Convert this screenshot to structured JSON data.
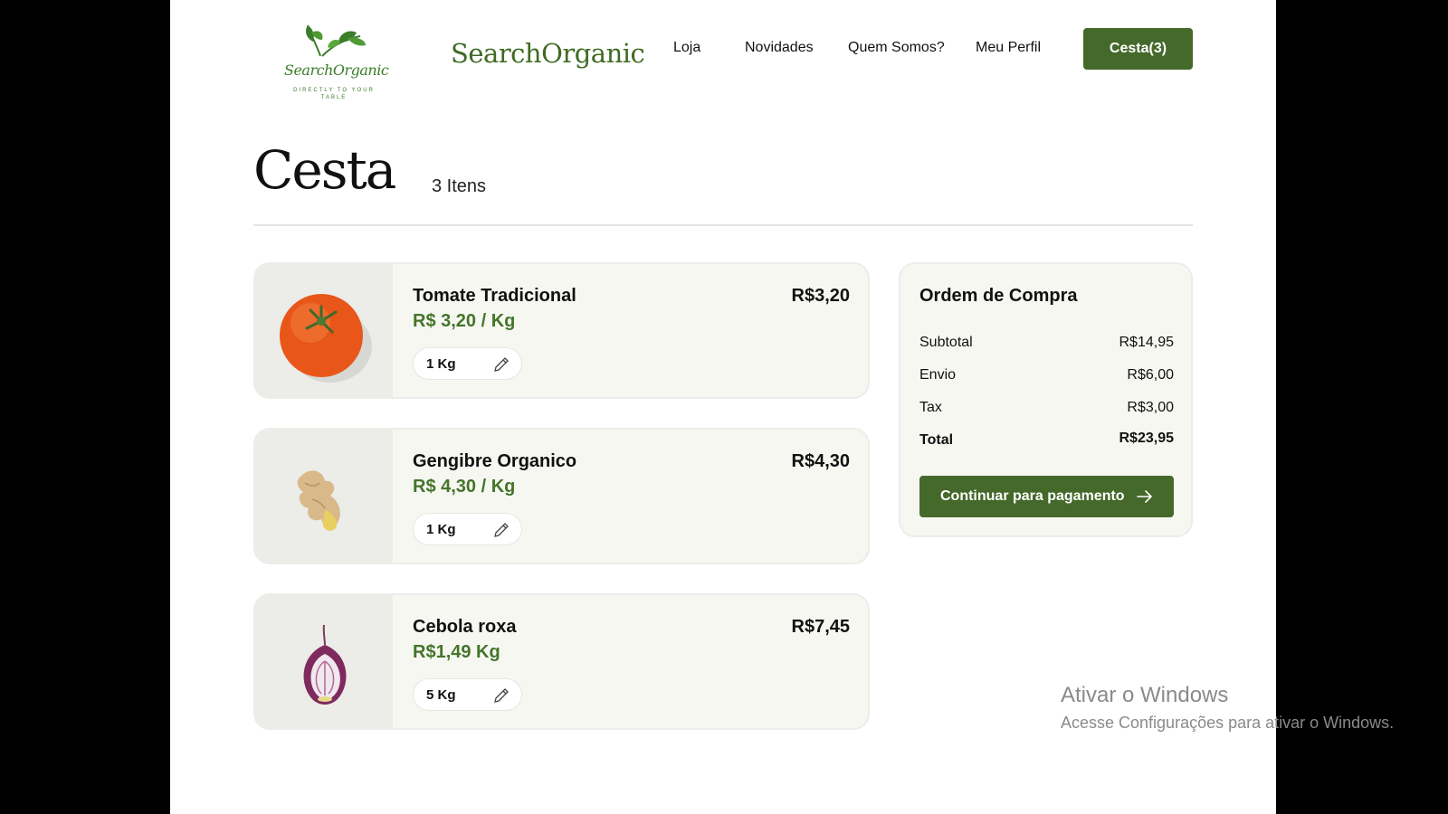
{
  "header": {
    "logo_text": "SearchOrganic",
    "logo_tagline": "DIRECTLY TO YOUR TABLE",
    "brand": "SearchOrganic",
    "nav": [
      "Loja",
      "Novidades",
      "Quem Somos?",
      "Meu Perfil"
    ],
    "cart_button": "Cesta(3)"
  },
  "page": {
    "title": "Cesta",
    "item_count": "3  Itens"
  },
  "items": [
    {
      "name": "Tomate Tradicional",
      "unit_price": "R$ 3,20 / Kg",
      "price": "R$3,20",
      "quantity": "1 Kg",
      "image": "tomato"
    },
    {
      "name": "Gengibre Organico",
      "unit_price": "R$ 4,30 / Kg",
      "price": "R$4,30",
      "quantity": "1 Kg",
      "image": "ginger"
    },
    {
      "name": "Cebola roxa",
      "unit_price": "R$1,49 Kg",
      "price": "R$7,45",
      "quantity": "5 Kg",
      "image": "red-onion"
    }
  ],
  "summary": {
    "title": "Ordem de Compra",
    "rows": [
      {
        "label": "Subtotal",
        "value": "R$14,95"
      },
      {
        "label": "Envio",
        "value": "R$6,00"
      },
      {
        "label": "Tax",
        "value": "R$3,00"
      },
      {
        "label": "Total",
        "value": "R$23,95"
      }
    ],
    "pay_button": "Continuar para pagamento"
  },
  "watermark": {
    "line1": "Ativar o Windows",
    "line2": "Acesse Configurações para ativar o Windows."
  },
  "colors": {
    "accent": "#44692a",
    "price_green": "#44752a",
    "card_bg": "#f7f7f2"
  }
}
